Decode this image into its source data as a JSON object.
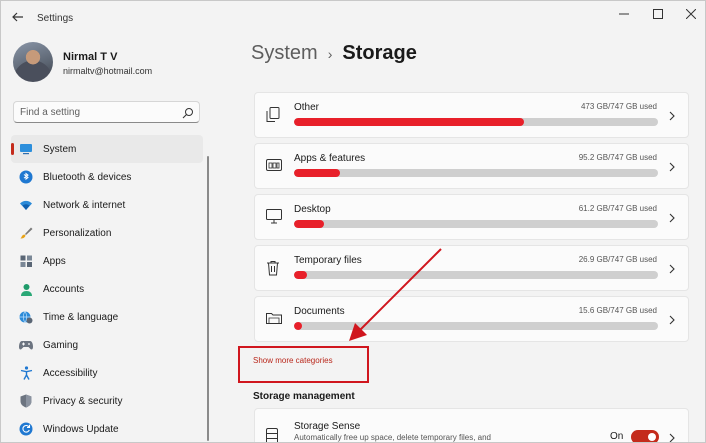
{
  "window": {
    "title": "Settings"
  },
  "user": {
    "name": "Nirmal T V",
    "email": "nirmaltv@hotmail.com"
  },
  "search": {
    "placeholder": "Find a setting"
  },
  "sidebar": {
    "items": [
      {
        "label": "System",
        "icon": "monitor-icon",
        "selected": true
      },
      {
        "label": "Bluetooth & devices",
        "icon": "bluetooth-icon"
      },
      {
        "label": "Network & internet",
        "icon": "wifi-icon"
      },
      {
        "label": "Personalization",
        "icon": "brush-icon"
      },
      {
        "label": "Apps",
        "icon": "apps-grid-icon"
      },
      {
        "label": "Accounts",
        "icon": "person-icon"
      },
      {
        "label": "Time & language",
        "icon": "globe-clock-icon"
      },
      {
        "label": "Gaming",
        "icon": "gamepad-icon"
      },
      {
        "label": "Accessibility",
        "icon": "accessibility-icon"
      },
      {
        "label": "Privacy & security",
        "icon": "shield-icon"
      },
      {
        "label": "Windows Update",
        "icon": "update-icon"
      }
    ]
  },
  "breadcrumb": {
    "parent": "System",
    "separator": "›",
    "current": "Storage"
  },
  "storage_categories": [
    {
      "name": "Other",
      "used": "473 GB/747 GB used",
      "fraction": 0.633,
      "icon": "file-stack-icon"
    },
    {
      "name": "Apps & features",
      "used": "95.2 GB/747 GB used",
      "fraction": 0.127,
      "icon": "apps-window-icon"
    },
    {
      "name": "Desktop",
      "used": "61.2 GB/747 GB used",
      "fraction": 0.082,
      "icon": "desktop-icon"
    },
    {
      "name": "Temporary files",
      "used": "26.9 GB/747 GB used",
      "fraction": 0.036,
      "icon": "trash-icon"
    },
    {
      "name": "Documents",
      "used": "15.6 GB/747 GB used",
      "fraction": 0.021,
      "icon": "folder-icon"
    }
  ],
  "show_more": "Show more categories",
  "storage_management": {
    "heading": "Storage management",
    "storage_sense": {
      "title": "Storage Sense",
      "description": "Automatically free up space, delete temporary files, and",
      "toggle_label": "On",
      "toggle_on": true
    }
  },
  "colors": {
    "accent": "#c42b1c",
    "bar_fill": "#e8202a",
    "annotation": "#d0161e"
  }
}
